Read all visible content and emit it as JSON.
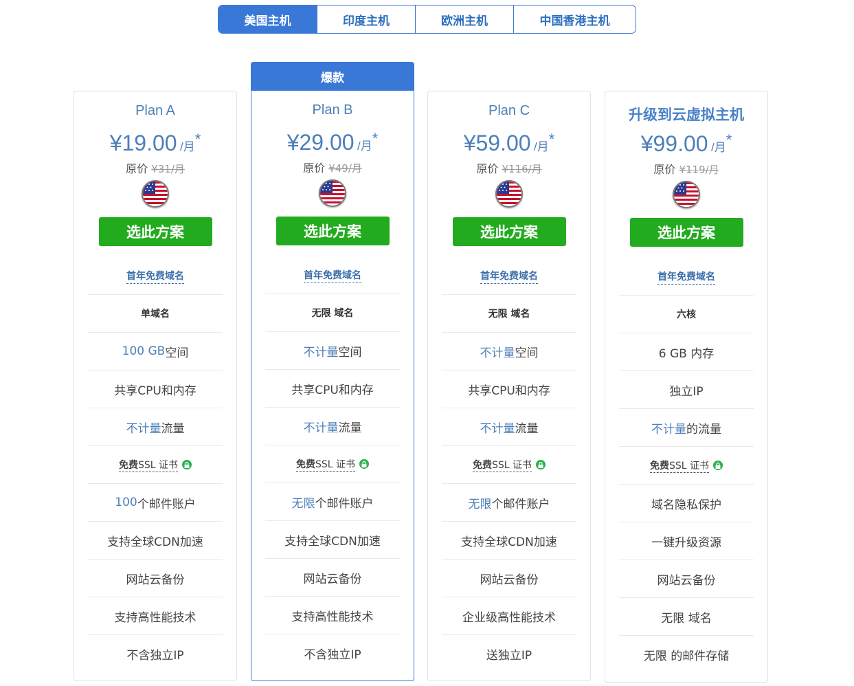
{
  "tabs": [
    {
      "label": "美国主机",
      "active": true
    },
    {
      "label": "印度主机",
      "active": false
    },
    {
      "label": "欧洲主机",
      "active": false
    },
    {
      "label": "中国香港主机",
      "active": false
    }
  ],
  "featured_badge": "爆款",
  "orig_label": "原价",
  "per_month": "/月",
  "star": "*",
  "choose_label": "选此方案",
  "free_domain_label": "首年免费域名",
  "ssl": {
    "bold": "免费",
    "text": "SSL 证书"
  },
  "plans": [
    {
      "name": "Plan A",
      "price": "¥19.00",
      "orig": "¥31/月",
      "features": {
        "f1": "单域名",
        "f2_hl": "100 GB",
        "f2_text": " 空间",
        "f3": "共享CPU和内存",
        "f4_hl": "不计量",
        "f4_text": " 流量",
        "f6_hl": "100",
        "f6_text": " 个邮件账户",
        "f7": "支持全球CDN加速",
        "f8": "网站云备份",
        "f9": "支持高性能技术",
        "f10": "不含独立IP"
      }
    },
    {
      "name": "Plan B",
      "price": "¥29.00",
      "orig": "¥49/月",
      "features": {
        "f1": "无限 域名",
        "f2_hl": "不计量",
        "f2_text": " 空间",
        "f3": "共享CPU和内存",
        "f4_hl": "不计量",
        "f4_text": " 流量",
        "f6_hl": "无限",
        "f6_text": " 个邮件账户",
        "f7": "支持全球CDN加速",
        "f8": "网站云备份",
        "f9": "支持高性能技术",
        "f10": "不含独立IP"
      }
    },
    {
      "name": "Plan C",
      "price": "¥59.00",
      "orig": "¥116/月",
      "features": {
        "f1": "无限 域名",
        "f2_hl": "不计量",
        "f2_text": " 空间",
        "f3": "共享CPU和内存",
        "f4_hl": "不计量",
        "f4_text": " 流量",
        "f6_hl": "无限",
        "f6_text": " 个邮件账户",
        "f7": "支持全球CDN加速",
        "f8": "网站云备份",
        "f9": "企业级高性能技术",
        "f10": "送独立IP"
      }
    },
    {
      "name": "升级到云虚拟主机",
      "price": "¥99.00",
      "orig": "¥119/月",
      "features": {
        "f1": "六核",
        "f2_text": "6 GB 内存",
        "f3": "独立IP",
        "f4_hl": "不计量",
        "f4_text": " 的流量",
        "f6": "域名隐私保护",
        "f7": "一键升级资源",
        "f8": "网站云备份",
        "f9": "无限 域名",
        "f10": "无限 的邮件存储"
      }
    }
  ]
}
